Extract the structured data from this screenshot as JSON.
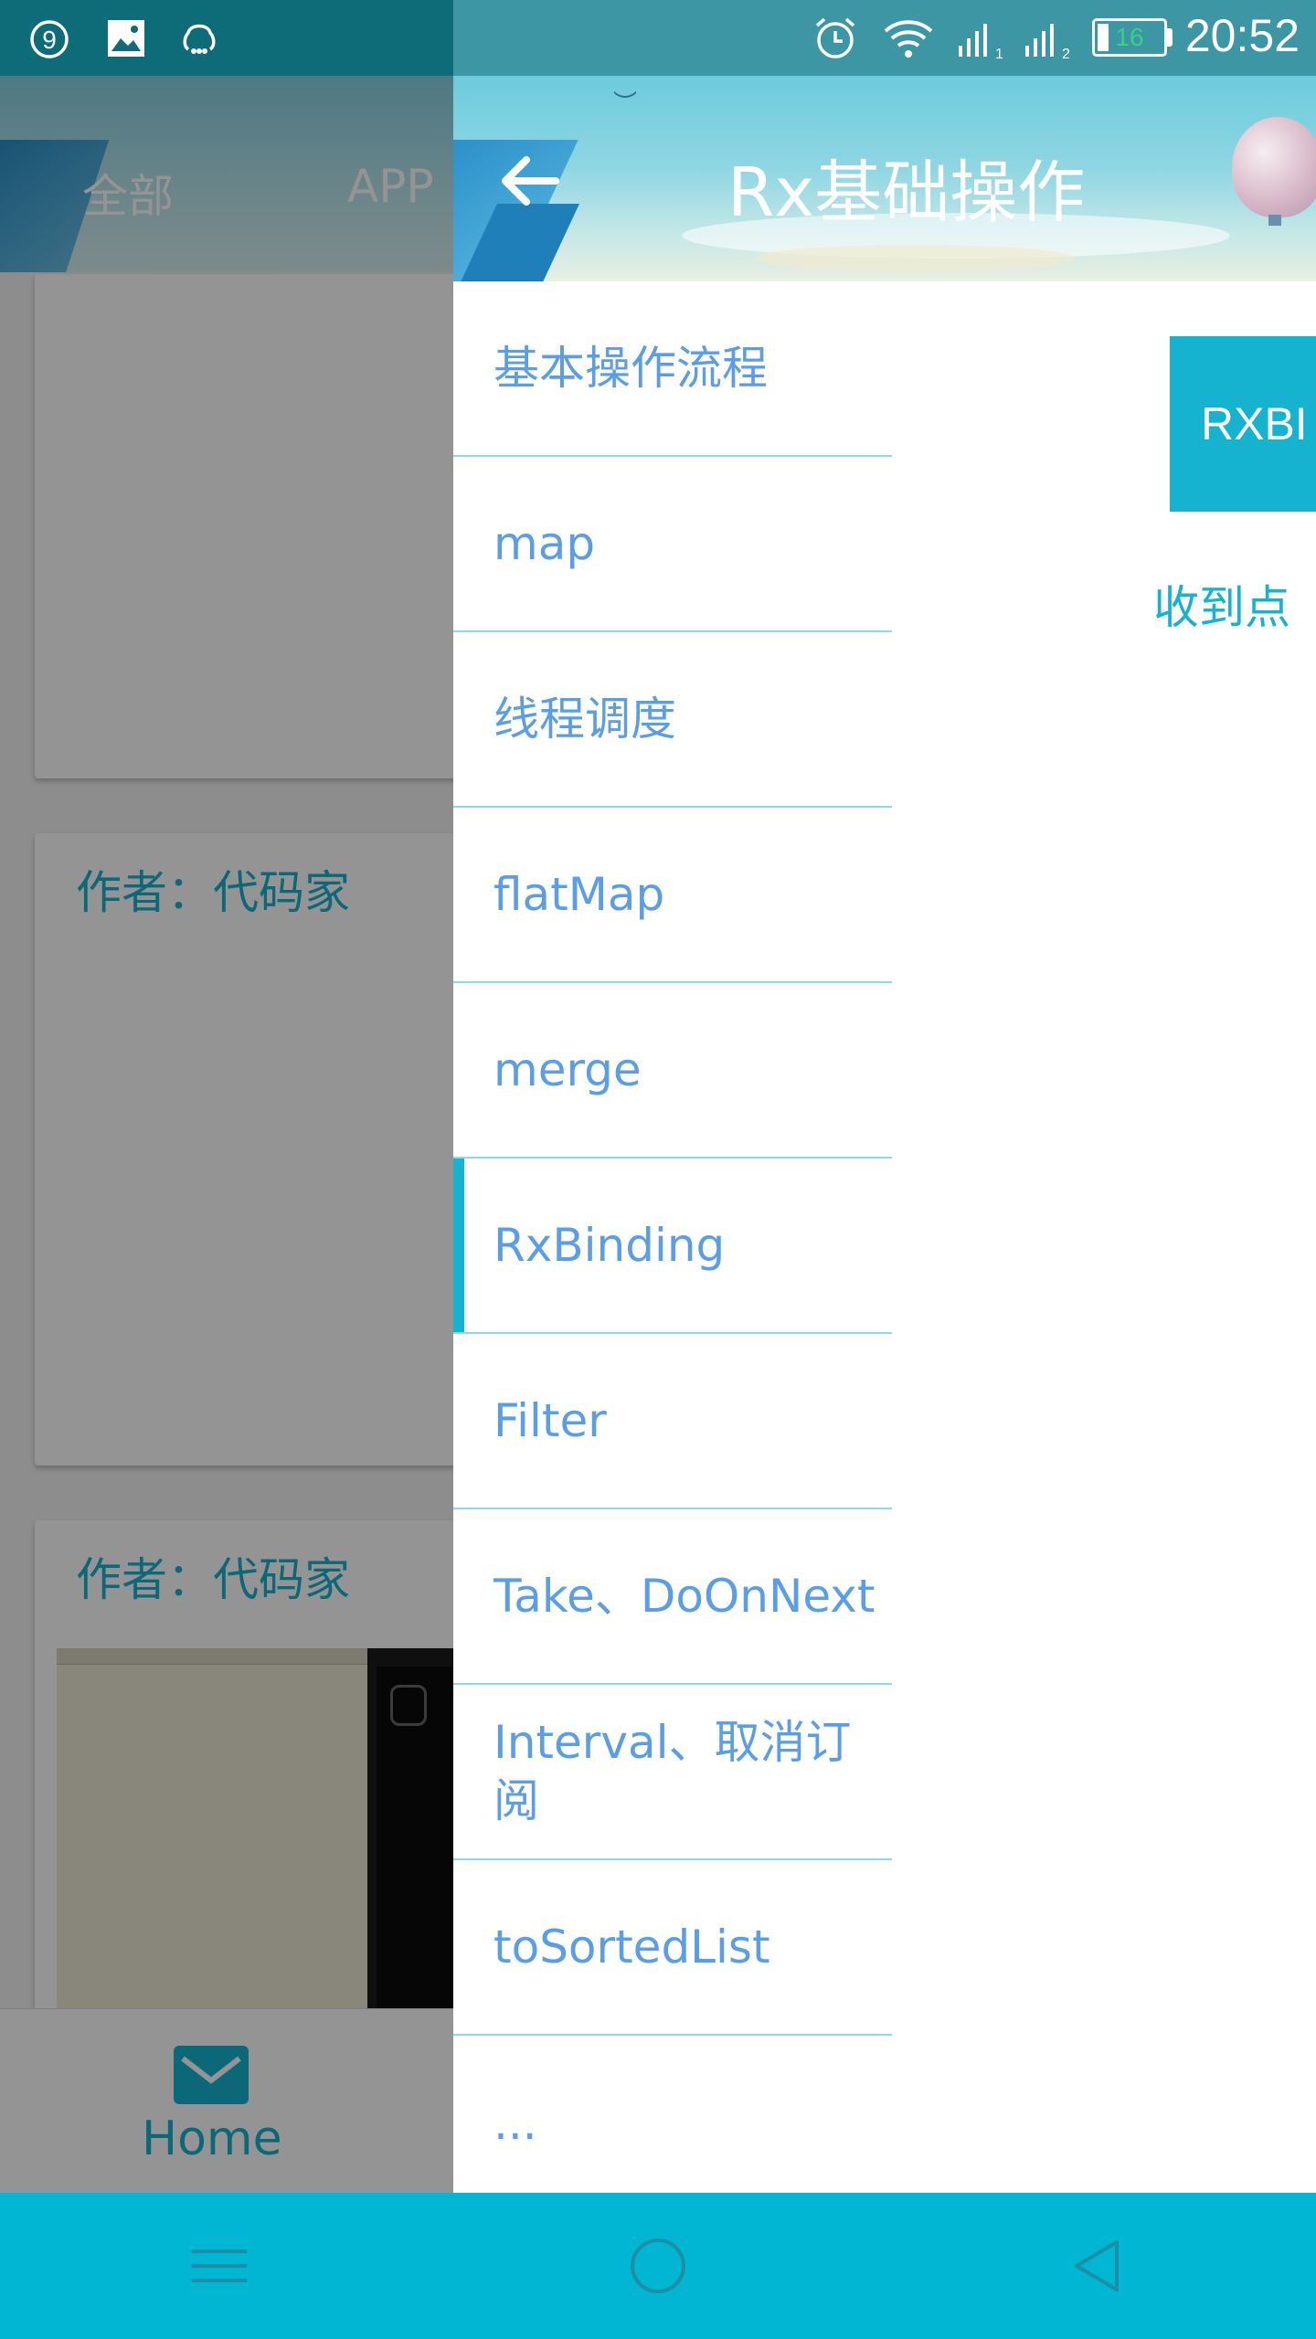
{
  "status_bar": {
    "time": "20:52",
    "battery_level": "16",
    "left_icons": [
      "notification-9-icon",
      "image-icon",
      "qq-icon"
    ],
    "right_icons": [
      "alarm-icon",
      "wifi-icon",
      "signal-1-icon",
      "signal-2-icon",
      "battery-icon"
    ]
  },
  "background_app": {
    "tabs": [
      "全部",
      "APP"
    ],
    "cards": [
      {
        "title": "作者：代码家"
      },
      {
        "title": "作者：代码家"
      }
    ],
    "bottom_nav": {
      "home_label": "Home",
      "home_icon": "mail-icon"
    }
  },
  "drawer": {
    "title": "Rx基础操作",
    "back_icon": "arrow-left-icon",
    "menu_items": [
      {
        "label": "基本操作流程"
      },
      {
        "label": "map"
      },
      {
        "label": "线程调度"
      },
      {
        "label": "flatMap"
      },
      {
        "label": "merge"
      },
      {
        "label": "RxBinding",
        "active": true
      },
      {
        "label": "Filter"
      },
      {
        "label": "Take、DoOnNext"
      },
      {
        "label": "Interval、取消订阅"
      },
      {
        "label": "toSortedList"
      },
      {
        "label": "..."
      }
    ],
    "content": {
      "button_label": "RXBI",
      "received_text": "收到点"
    }
  },
  "system_nav": {
    "buttons": [
      "menu-icon",
      "home-circle-icon",
      "back-triangle-icon"
    ]
  },
  "colors": {
    "accent": "#14b3d0",
    "menu_text": "#5b9de6",
    "divider": "#8fd9e6"
  }
}
